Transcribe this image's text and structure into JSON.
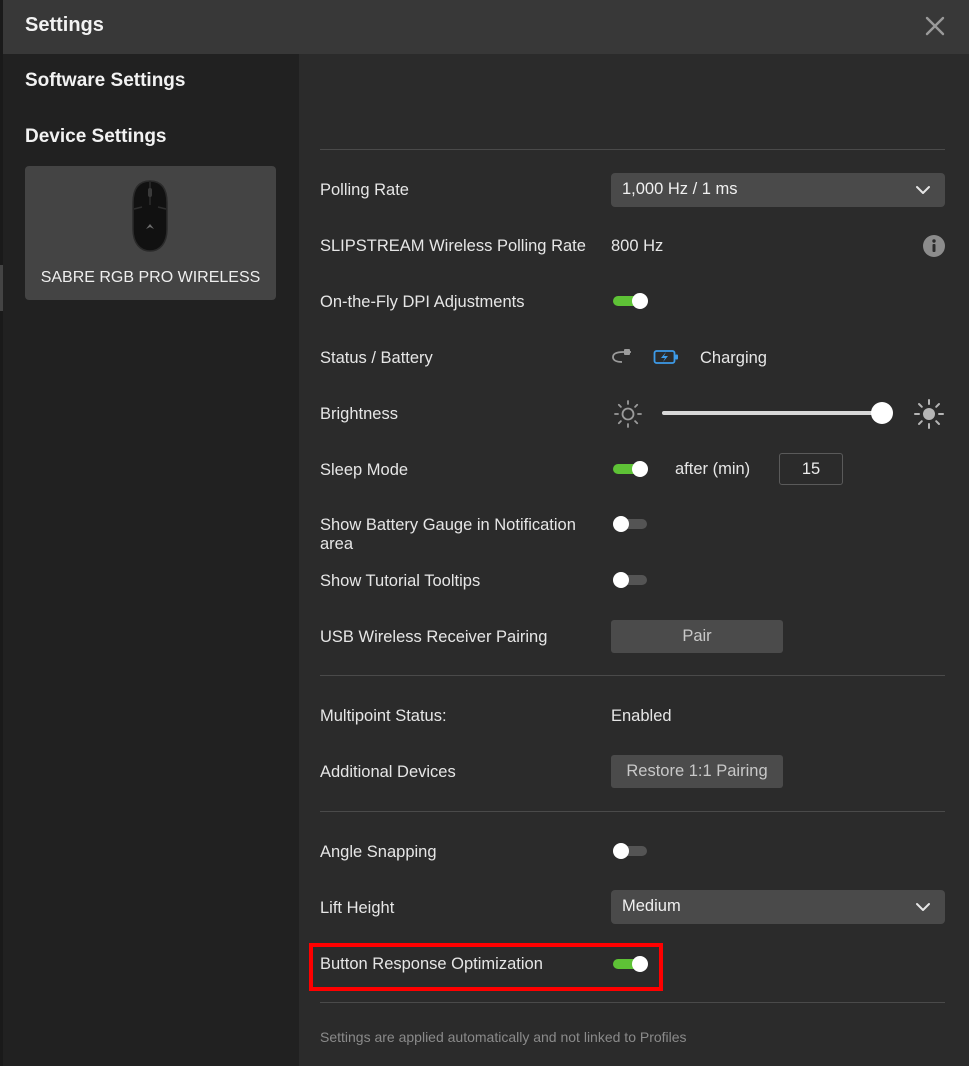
{
  "window": {
    "title": "Settings",
    "close_icon": "close-icon"
  },
  "sidebar": {
    "software_settings": "Software Settings",
    "device_settings": "Device Settings",
    "device": {
      "name": "SABRE RGB PRO WIRELESS",
      "icon": "mouse-icon"
    }
  },
  "settings": {
    "polling_rate": {
      "label": "Polling Rate",
      "selected": "1,000 Hz / 1 ms"
    },
    "slipstream": {
      "label": "SLIPSTREAM Wireless Polling Rate",
      "value": "800 Hz",
      "icon": "info-icon"
    },
    "dpi": {
      "label": "On-the-Fly DPI Adjustments",
      "enabled": true
    },
    "status_battery": {
      "label": "Status / Battery",
      "status": "Charging",
      "icons": [
        "usb-cable-icon",
        "battery-charging-icon"
      ]
    },
    "brightness": {
      "label": "Brightness",
      "level_percent": 100,
      "icons": [
        "brightness-low-icon",
        "brightness-high-icon"
      ]
    },
    "sleep_mode": {
      "label": "Sleep Mode",
      "enabled": true,
      "after_label": "after (min)",
      "minutes": "15"
    },
    "battery_gauge": {
      "label": "Show Battery Gauge in Notification area",
      "enabled": false
    },
    "tutorial_tooltips": {
      "label": "Show Tutorial Tooltips",
      "enabled": false
    },
    "usb_pairing": {
      "label": "USB Wireless Receiver Pairing",
      "button": "Pair"
    },
    "multipoint": {
      "label": "Multipoint Status:",
      "value": "Enabled"
    },
    "additional_devices": {
      "label": "Additional Devices",
      "button": "Restore 1:1 Pairing"
    },
    "angle_snapping": {
      "label": "Angle Snapping",
      "enabled": false
    },
    "lift_height": {
      "label": "Lift Height",
      "selected": "Medium"
    },
    "button_response": {
      "label": "Button Response Optimization",
      "enabled": true
    }
  },
  "footer": {
    "note": "Settings are applied automatically and not linked to Profiles"
  },
  "colors": {
    "toggle_on": "#5ec236",
    "highlight": "#ff0000",
    "charging_icon": "#3d9be9"
  }
}
